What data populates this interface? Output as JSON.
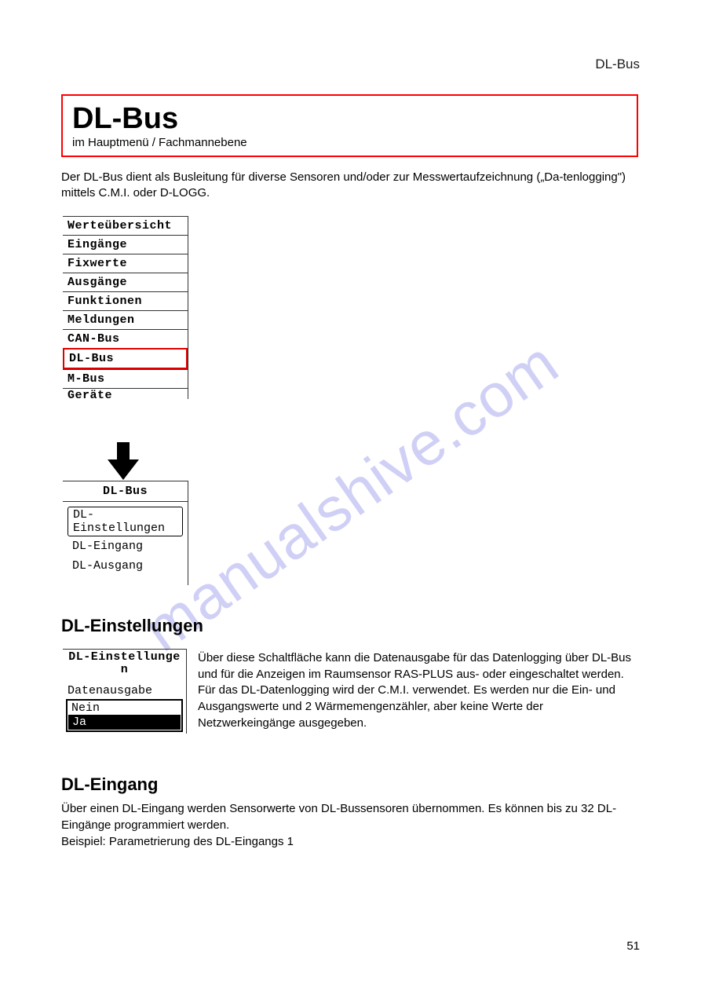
{
  "header": {
    "section_label": "DL-Bus"
  },
  "redbox": {
    "title": "DL-Bus",
    "subtitle": "im Hauptmenü / Fachmannebene"
  },
  "intro": "Der DL-Bus dient als Busleitung für diverse Sensoren und/oder zur Messwertaufzeichnung („Da-tenlogging\") mittels C.M.I. oder D-LOGG.",
  "menu1": {
    "items": [
      "Werteübersicht",
      "Eingänge",
      "Fixwerte",
      "Ausgänge",
      "Funktionen",
      "Meldungen",
      "CAN-Bus",
      "DL-Bus",
      "M-Bus",
      "Geräte"
    ],
    "selected_index": 7
  },
  "menu2": {
    "title": "DL-Bus",
    "items": [
      "DL-Einstellungen",
      "DL-Eingang",
      "DL-Ausgang"
    ],
    "selected_index": 0
  },
  "settings_header": "DL-Einstellungen",
  "menu3": {
    "title": "DL-Einstellunge n",
    "label": "Datenausgabe",
    "options": [
      "Nein",
      "Ja"
    ],
    "selected_index": 1
  },
  "settings_text": "Über diese Schaltfläche kann die Datenausgabe für das Datenlogging über DL-Bus und für die Anzeigen im Raumsensor RAS-PLUS aus- oder eingeschaltet werden. Für das DL-Datenlogging wird der C.M.I. verwendet. Es werden nur die Ein- und Ausgangswerte und 2 Wärmemengenzähler, aber keine Werte der Netzwerkeingänge ausgegeben.",
  "dl_input_title": "DL-Eingang",
  "dl_input_text": "Über einen DL-Eingang werden Sensorwerte von DL-Bussensoren übernommen. Es können bis zu 32 DL-Eingänge programmiert werden.\nBeispiel: Parametrierung des DL-Eingangs 1",
  "footer": {
    "page": "51"
  },
  "watermark": "manualshive.com"
}
